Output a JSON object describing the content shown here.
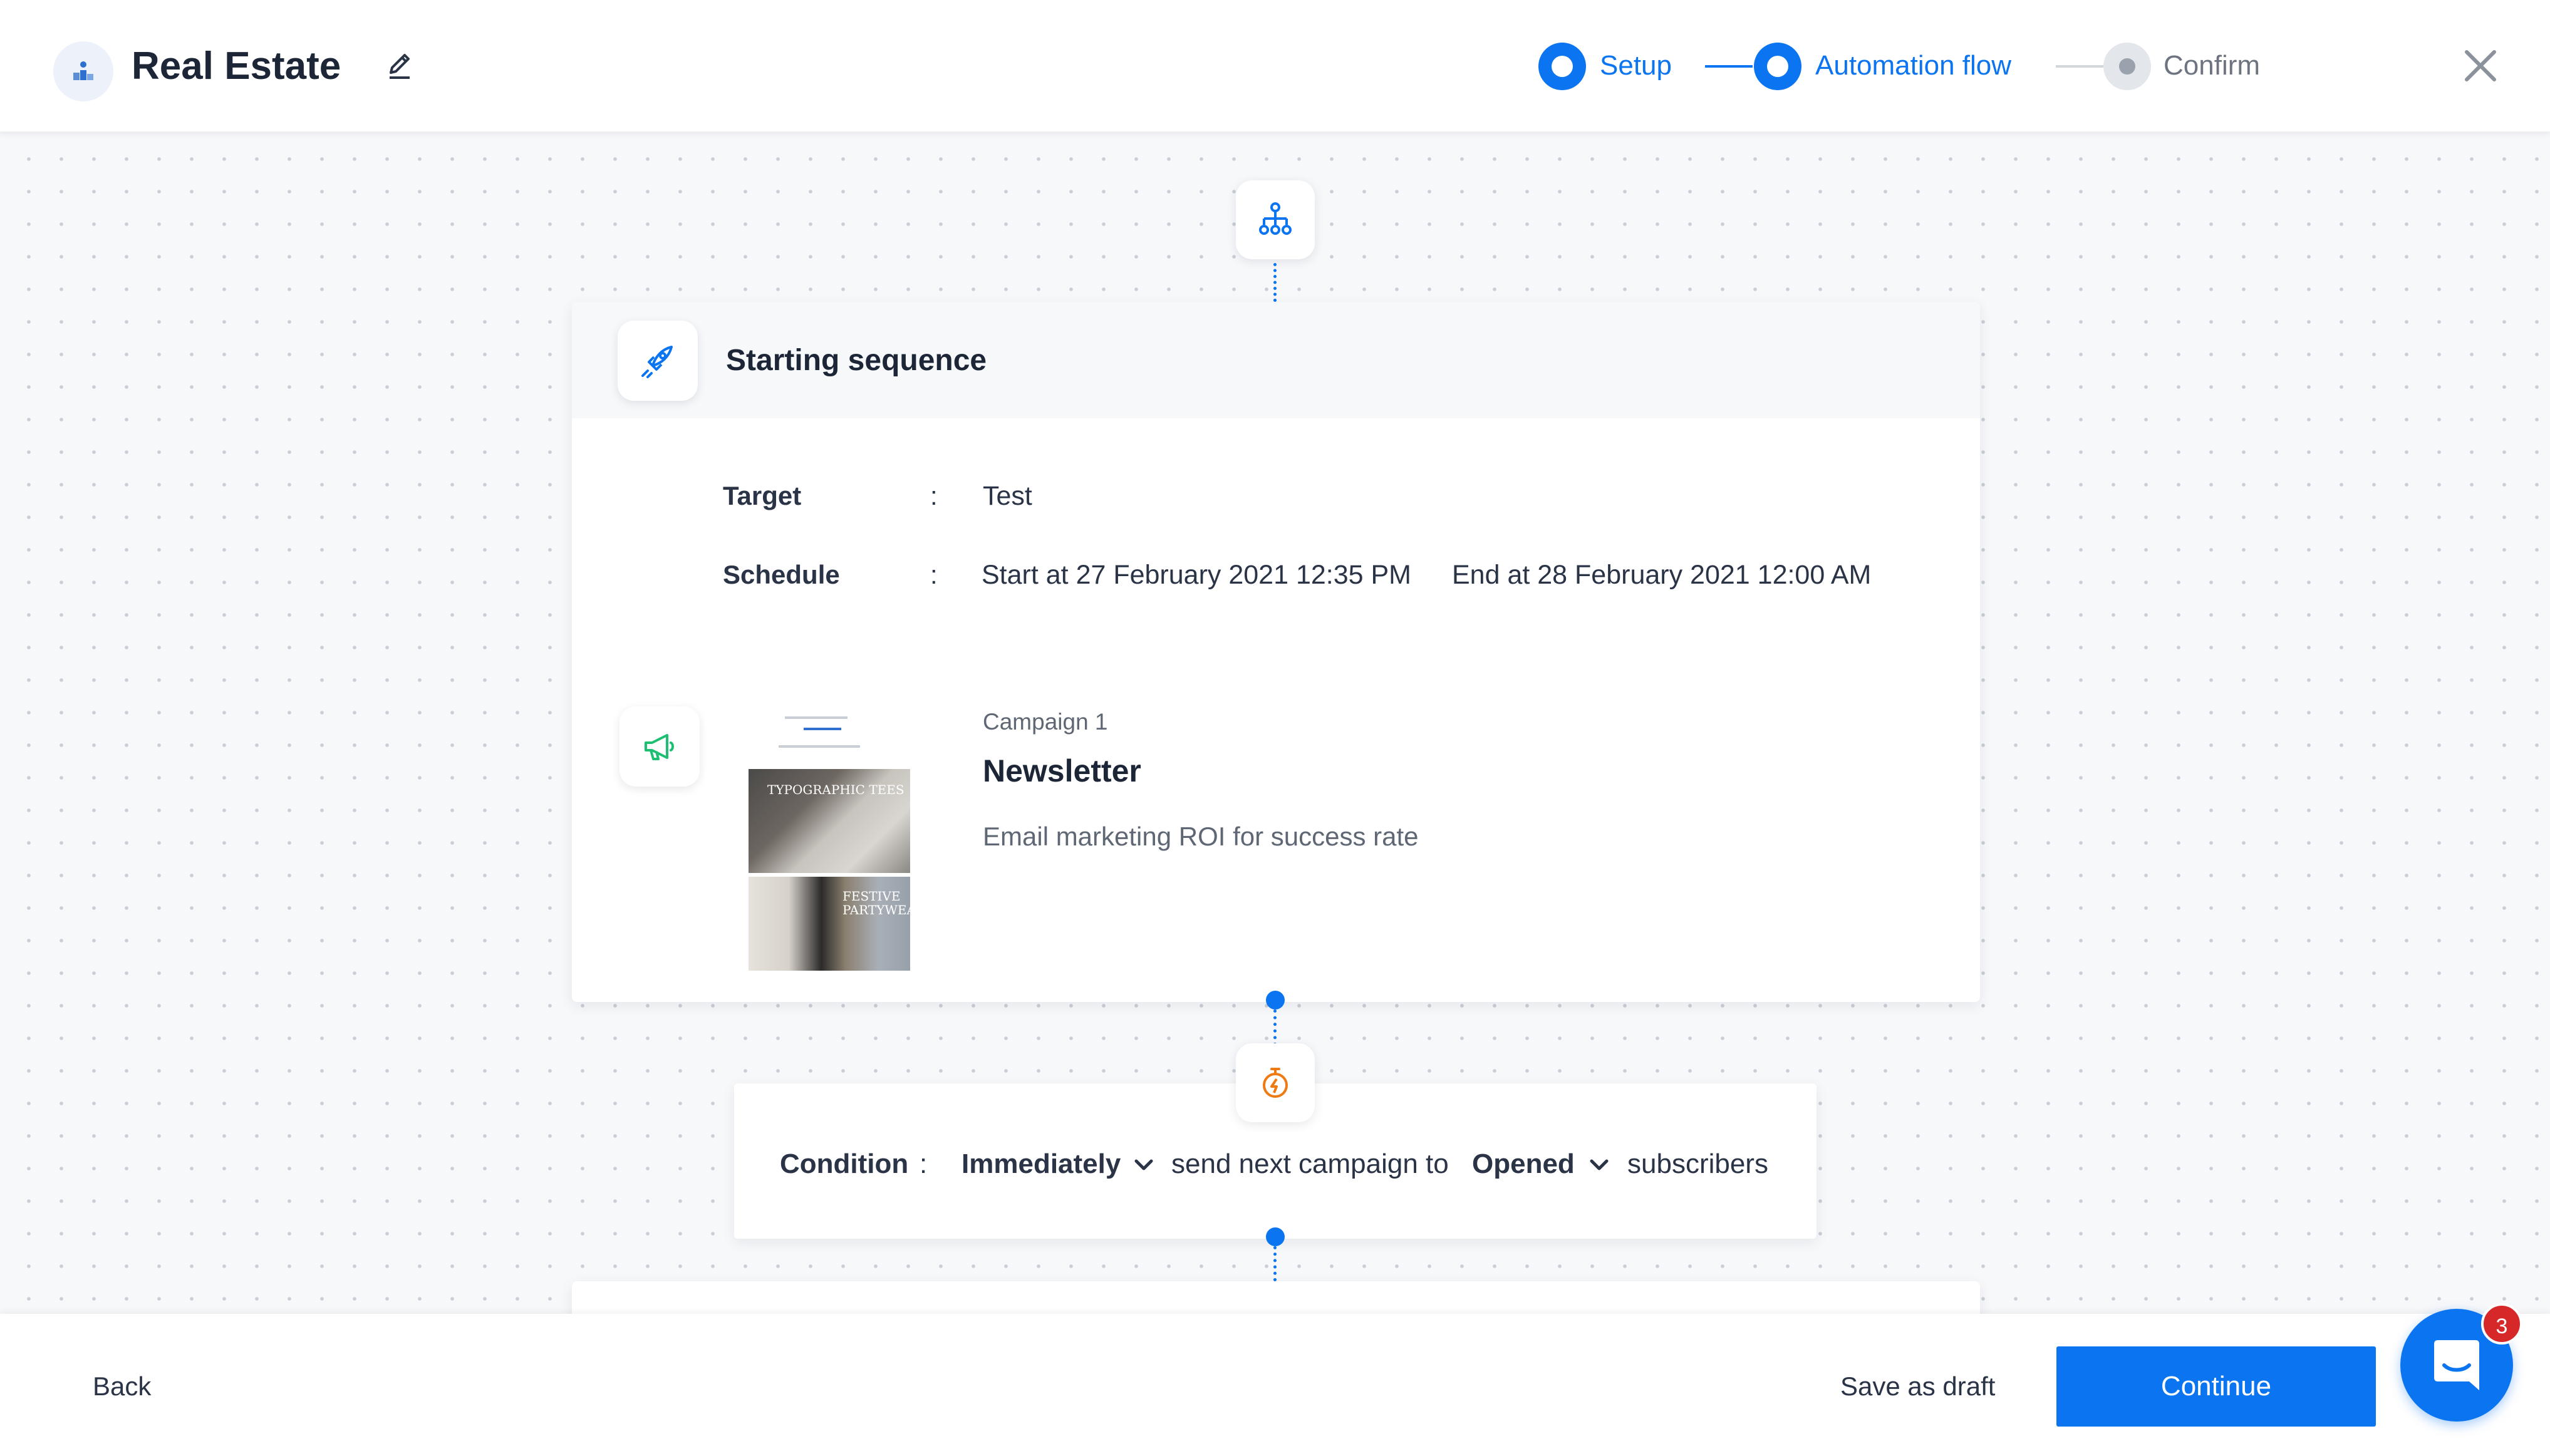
{
  "header": {
    "title": "Real Estate",
    "steps": [
      {
        "label": "Setup",
        "state": "active"
      },
      {
        "label": "Automation flow",
        "state": "active"
      },
      {
        "label": "Confirm",
        "state": "pending"
      }
    ],
    "icons": {
      "logo": "app-logo-icon",
      "edit": "pencil-icon",
      "close": "close-icon"
    }
  },
  "flow": {
    "top_node_icon": "flow-hierarchy-icon",
    "start_card": {
      "title": "Starting sequence",
      "icon": "rocket-icon",
      "target_label": "Target",
      "target_value": "Test",
      "schedule_label": "Schedule",
      "colon": ":",
      "schedule_start": "Start at 27 February 2021 12:35 PM",
      "schedule_end": "End at 28 February 2021 12:00 AM",
      "campaign": {
        "icon": "megaphone-icon",
        "subtitle": "Campaign 1",
        "title": "Newsletter",
        "description": "Email marketing ROI for success rate",
        "thumb_text_1": "TYPOGRAPHIC TEES",
        "thumb_text_2": "FESTIVE PARTYWEAR"
      }
    },
    "condition": {
      "icon": "timer-icon",
      "label": "Condition",
      "colon": ":",
      "timing": "Immediately",
      "middle_text": "send next campaign to",
      "status": "Opened",
      "end_text": "subscribers"
    }
  },
  "footer": {
    "back_label": "Back",
    "draft_label": "Save as draft",
    "continue_label": "Continue",
    "chat_badge": "3"
  },
  "colors": {
    "accent": "#0b74f1",
    "timer": "#f07a12",
    "megaphone": "#1dbf73",
    "badge": "#d62828"
  }
}
